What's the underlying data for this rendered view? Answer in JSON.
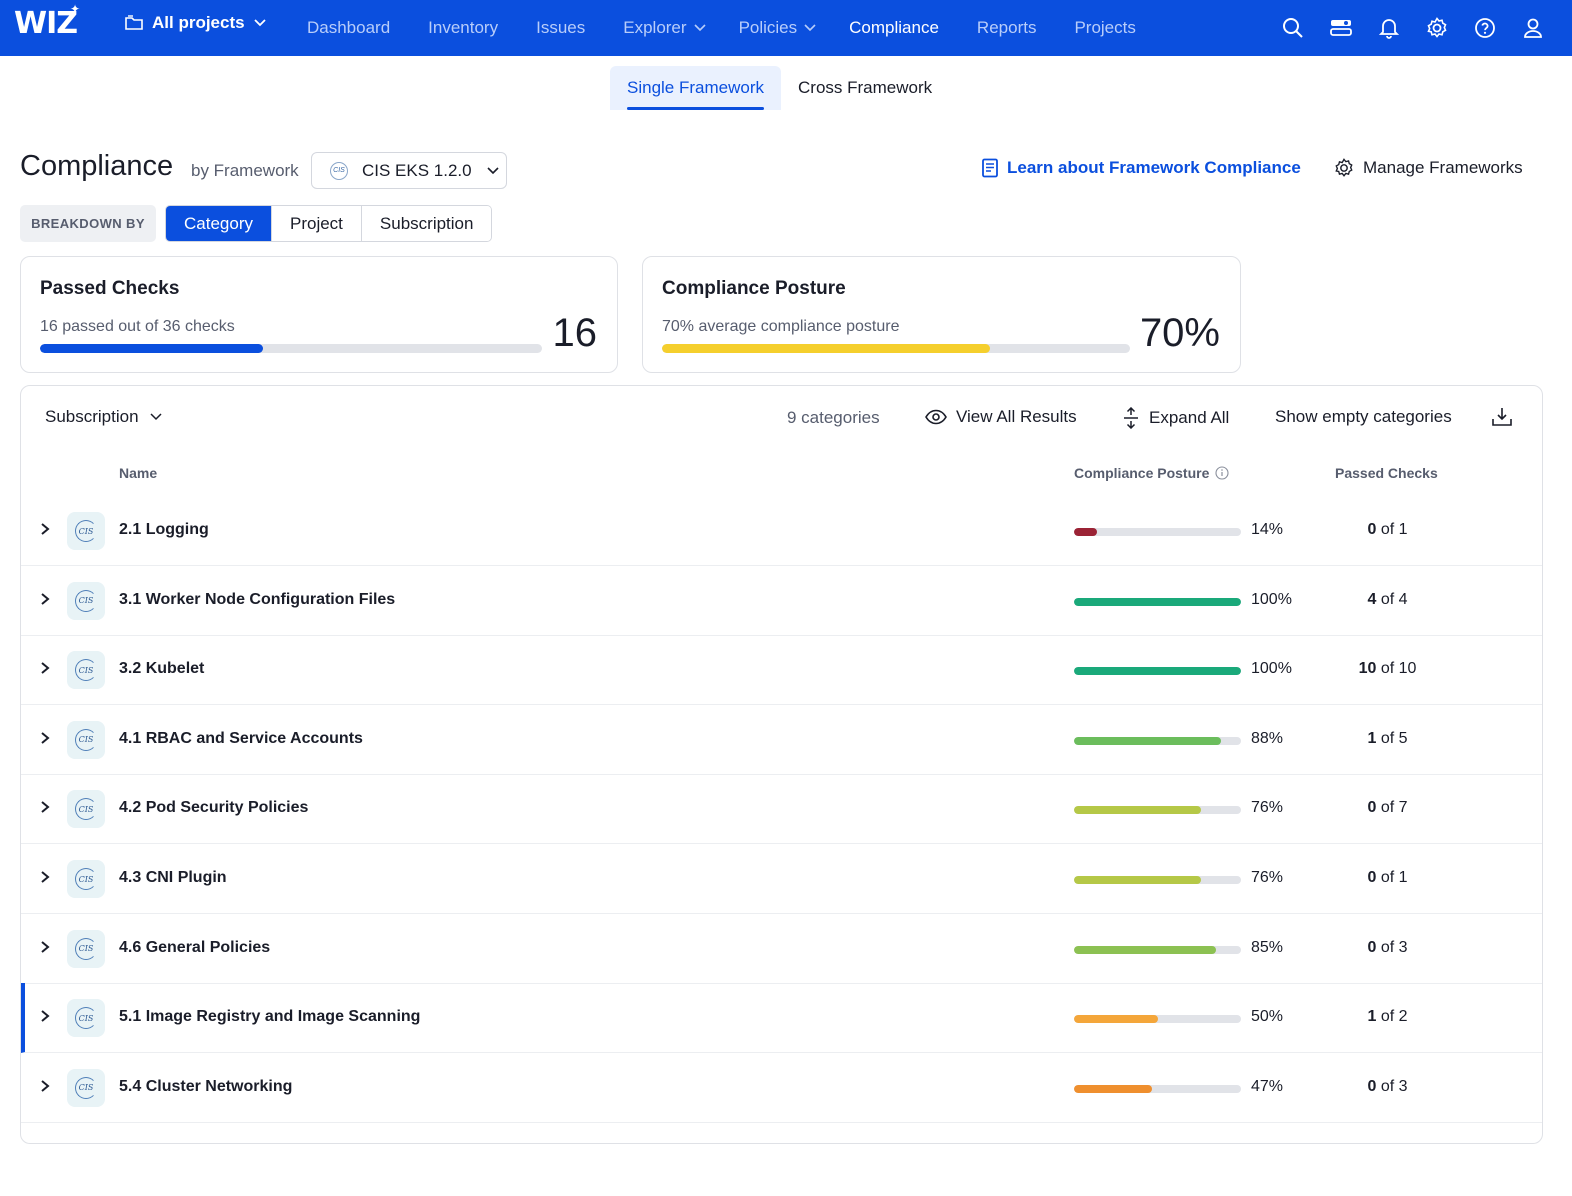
{
  "nav": {
    "logo": "WIZ",
    "projects_label": "All projects",
    "items": [
      {
        "label": "Dashboard",
        "dropdown": false,
        "active": false
      },
      {
        "label": "Inventory",
        "dropdown": false,
        "active": false
      },
      {
        "label": "Issues",
        "dropdown": false,
        "active": false
      },
      {
        "label": "Explorer",
        "dropdown": true,
        "active": false
      },
      {
        "label": "Policies",
        "dropdown": true,
        "active": false
      },
      {
        "label": "Compliance",
        "dropdown": false,
        "active": true
      },
      {
        "label": "Reports",
        "dropdown": false,
        "active": false
      },
      {
        "label": "Projects",
        "dropdown": false,
        "active": false
      }
    ],
    "icons": [
      "search-icon",
      "toggle-panel-icon",
      "bell-icon",
      "gear-icon",
      "help-icon",
      "user-icon"
    ]
  },
  "subtabs": [
    {
      "label": "Single Framework",
      "active": true
    },
    {
      "label": "Cross Framework",
      "active": false
    }
  ],
  "header": {
    "title": "Compliance",
    "by": "by Framework",
    "framework": "CIS EKS 1.2.0",
    "learn_link": "Learn about Framework Compliance",
    "manage": "Manage Frameworks"
  },
  "breakdown": {
    "label": "BREAKDOWN BY",
    "options": [
      {
        "label": "Category",
        "active": true
      },
      {
        "label": "Project",
        "active": false
      },
      {
        "label": "Subscription",
        "active": false
      }
    ]
  },
  "cards": {
    "passed": {
      "title": "Passed Checks",
      "subtitle": "16 passed out of 36 checks",
      "value": "16",
      "fraction": 0.444
    },
    "posture": {
      "title": "Compliance Posture",
      "subtitle": "70% average compliance posture",
      "value": "70%",
      "fraction": 0.7
    }
  },
  "toolbar": {
    "group_by": "Subscription",
    "count": "9 categories",
    "view_all": "View All Results",
    "expand_all": "Expand All",
    "show_empty": "Show empty categories"
  },
  "columns": {
    "name": "Name",
    "posture": "Compliance Posture",
    "checks": "Passed Checks"
  },
  "rows": [
    {
      "name": "2.1 Logging",
      "posture": "14%",
      "fraction": 0.14,
      "color": "#9b2335",
      "passed": "0",
      "of": "of 1",
      "selected": false
    },
    {
      "name": "3.1 Worker Node Configuration Files",
      "posture": "100%",
      "fraction": 1.0,
      "color": "#1aa97a",
      "passed": "4",
      "of": "of 4",
      "selected": false
    },
    {
      "name": "3.2 Kubelet",
      "posture": "100%",
      "fraction": 1.0,
      "color": "#1aa97a",
      "passed": "10",
      "of": "of 10",
      "selected": false
    },
    {
      "name": "4.1 RBAC and Service Accounts",
      "posture": "88%",
      "fraction": 0.88,
      "color": "#6bbd5c",
      "passed": "1",
      "of": "of 5",
      "selected": false
    },
    {
      "name": "4.2 Pod Security Policies",
      "posture": "76%",
      "fraction": 0.76,
      "color": "#b5c847",
      "passed": "0",
      "of": "of 7",
      "selected": false
    },
    {
      "name": "4.3 CNI Plugin",
      "posture": "76%",
      "fraction": 0.76,
      "color": "#b5c847",
      "passed": "0",
      "of": "of 1",
      "selected": false
    },
    {
      "name": "4.6 General Policies",
      "posture": "85%",
      "fraction": 0.85,
      "color": "#8cc152",
      "passed": "0",
      "of": "of 3",
      "selected": false
    },
    {
      "name": "5.1 Image Registry and Image Scanning",
      "posture": "50%",
      "fraction": 0.5,
      "color": "#f4a63a",
      "passed": "1",
      "of": "of 2",
      "selected": true
    },
    {
      "name": "5.4 Cluster Networking",
      "posture": "47%",
      "fraction": 0.47,
      "color": "#ef8f2e",
      "passed": "0",
      "of": "of 3",
      "selected": false
    }
  ],
  "colors": {
    "brand": "#0b4fde",
    "passed_bar": "#0b4fde",
    "posture_bar": "#f5cf2d"
  }
}
